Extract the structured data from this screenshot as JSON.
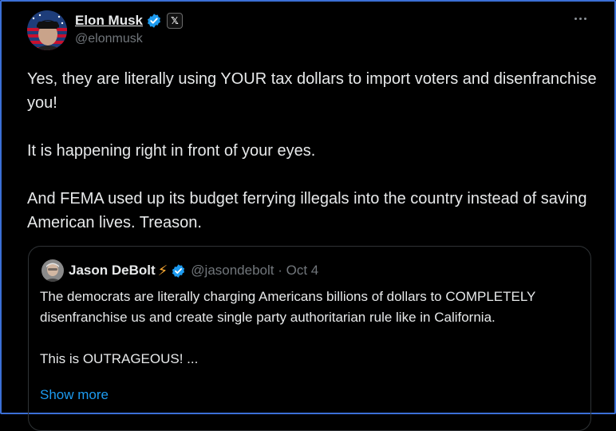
{
  "colors": {
    "background": "#000000",
    "text": "#e7e9ea",
    "muted": "#71767b",
    "link": "#1d9bf0",
    "verified": "#1d9bf0"
  },
  "tweet": {
    "author_name": "Elon Musk",
    "author_handle": "@elonmusk",
    "affiliation_badge": "𝕏",
    "text": "Yes, they are literally using YOUR tax dollars to import voters and disenfranchise you!\n\nIt is happening right in front of your eyes.\n\nAnd FEMA used up its budget ferrying illegals into the country instead of saving American lives. Treason."
  },
  "quoted": {
    "author_name": "Jason DeBolt",
    "emoji": "⚡",
    "meta": "@jasondebolt · Oct 4",
    "text": "The democrats are literally charging Americans billions of dollars to COMPLETELY disenfranchise us and create single party authoritarian rule like in California.\n\nThis is OUTRAGEOUS! ...",
    "show_more": "Show more"
  },
  "icons": {
    "verified": "verified-badge-icon",
    "more": "more-options-icon"
  }
}
